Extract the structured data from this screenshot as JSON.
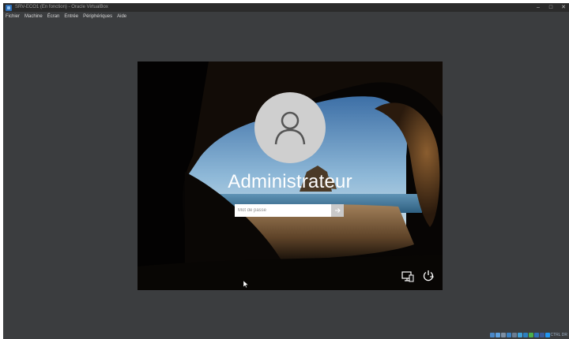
{
  "window": {
    "title": "SRV-ECO1 (En fonction) - Oracle VirtualBox",
    "minimize_glyph": "–",
    "maximize_glyph": "□",
    "close_glyph": "✕"
  },
  "menubar": {
    "items": [
      "Fichier",
      "Machine",
      "Écran",
      "Entrée",
      "Périphériques",
      "Aide"
    ]
  },
  "login": {
    "username": "Administrateur",
    "password_placeholder": "Mot de passe",
    "submit_glyph": "→"
  },
  "colors": {
    "host_background": "#3b3d3f",
    "avatar": "#cfcfcf",
    "submit": "#c9c9c9"
  },
  "status_bar": {
    "icons": [
      "disk-icon",
      "optical-icon",
      "audio-icon",
      "network-icon",
      "usb-icon",
      "shared-folder-icon",
      "display-icon",
      "record-icon",
      "cpu-icon",
      "mouse-icon",
      "keyboard-icon"
    ],
    "host_key": "CTRL DR"
  }
}
